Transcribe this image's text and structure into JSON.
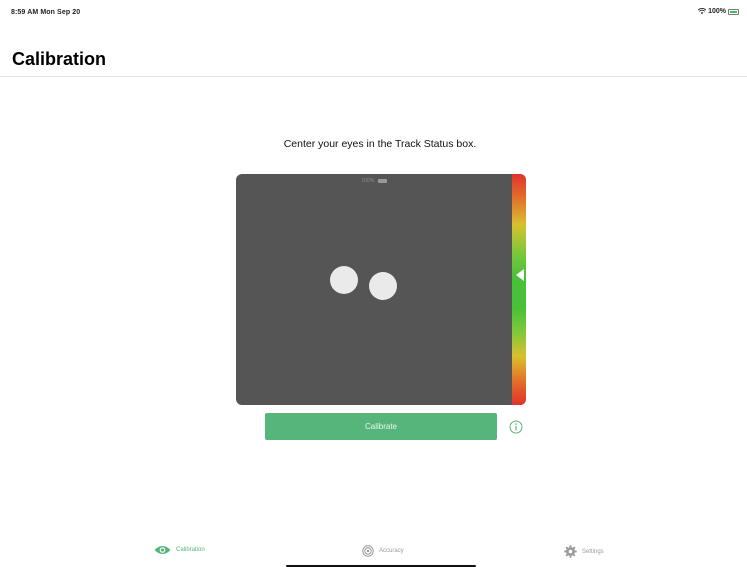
{
  "status_bar": {
    "time_date": "8:59 AM  Mon Sep 20",
    "battery_text": "100%",
    "wifi_icon": "wifi-icon",
    "battery_icon": "battery-icon"
  },
  "header": {
    "title": "Calibration"
  },
  "main": {
    "instruction": "Center your eyes in the Track Status box.",
    "track_box": {
      "inner_label": "100%",
      "background_color": "#555555",
      "eye_color": "#eaeaea"
    },
    "calibrate_button": {
      "label": "Calibrate",
      "color": "#56b67a"
    },
    "info_icon": "info-icon"
  },
  "tab_bar": {
    "accent": "#56b67a",
    "inactive_color": "#9b9b9b",
    "items": [
      {
        "label": "Calibration",
        "icon": "eye-icon",
        "active": true
      },
      {
        "label": "Accuracy",
        "icon": "target-icon",
        "active": false
      },
      {
        "label": "Settings",
        "icon": "gear-icon",
        "active": false
      }
    ]
  }
}
